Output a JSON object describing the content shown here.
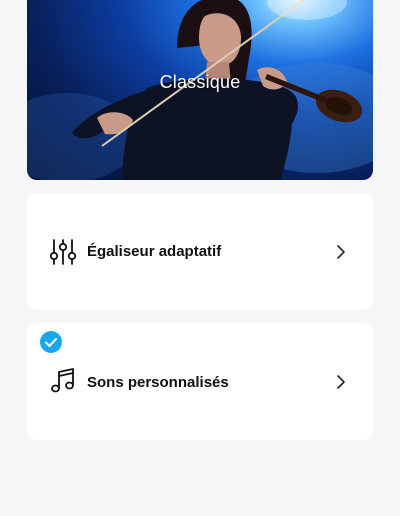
{
  "hero": {
    "title": "Classique",
    "image": "violinist-photo"
  },
  "options": [
    {
      "label": "Égaliseur adaptatif",
      "icon": "equalizer-sliders-icon",
      "selected": false
    },
    {
      "label": "Sons personnalisés",
      "icon": "music-note-icon",
      "selected": true
    }
  ],
  "colors": {
    "background": "#f6f6f8",
    "card": "#ffffff",
    "accent": "#1aa7ec",
    "text": "#111111"
  }
}
